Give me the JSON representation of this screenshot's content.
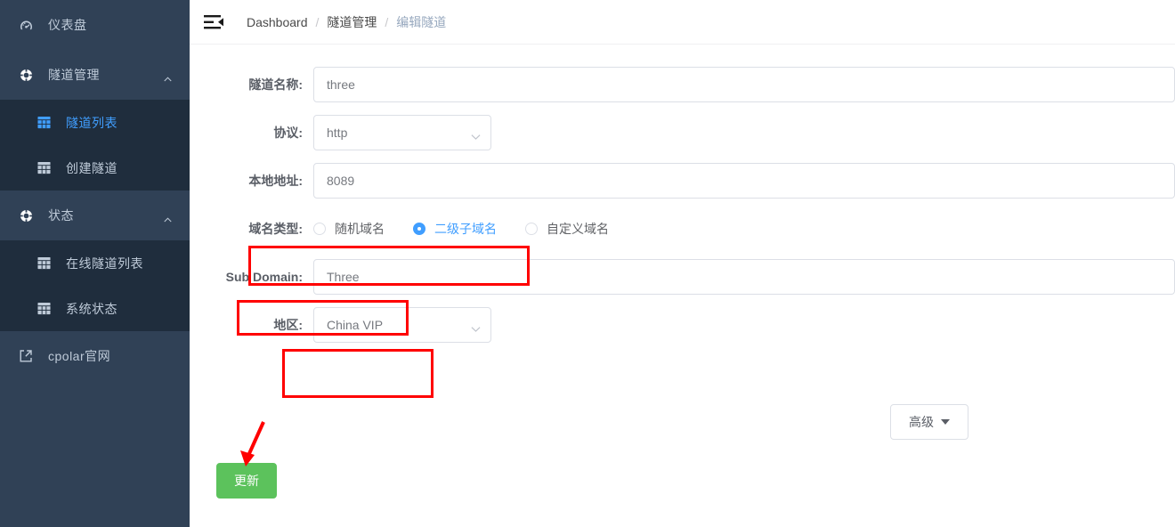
{
  "sidebar": {
    "items": [
      {
        "label": "仪表盘",
        "icon": "dashboard-gauge-icon",
        "type": "top",
        "active": false,
        "expandable": false
      },
      {
        "label": "隧道管理",
        "icon": "tunnel-compass-icon",
        "type": "top",
        "active": false,
        "expandable": true,
        "expanded": true
      },
      {
        "label": "隧道列表",
        "icon": "table-grid-icon",
        "type": "sub",
        "active": true
      },
      {
        "label": "创建隧道",
        "icon": "table-grid-icon",
        "type": "sub",
        "active": false
      },
      {
        "label": "状态",
        "icon": "status-compass-icon",
        "type": "top",
        "active": false,
        "expandable": true,
        "expanded": true
      },
      {
        "label": "在线隧道列表",
        "icon": "table-grid-icon",
        "type": "sub",
        "active": false
      },
      {
        "label": "系统状态",
        "icon": "table-grid-icon",
        "type": "sub",
        "active": false
      },
      {
        "label": "cpolar官网",
        "icon": "external-link-icon",
        "type": "top",
        "active": false,
        "expandable": false
      }
    ]
  },
  "navbar": {
    "menu_toggle_icon": "menu-fold-icon",
    "breadcrumb": [
      {
        "label": "Dashboard",
        "current": false
      },
      {
        "label": "隧道管理",
        "current": false
      },
      {
        "label": "编辑隧道",
        "current": true
      }
    ],
    "separator": "/"
  },
  "form": {
    "tunnel_name": {
      "label": "隧道名称:",
      "value": "three"
    },
    "protocol": {
      "label": "协议:",
      "value": "http",
      "caret_icon": "chevron-down-icon"
    },
    "local_address": {
      "label": "本地地址:",
      "value": "8089"
    },
    "domain_type": {
      "label": "域名类型:",
      "options": [
        {
          "label": "随机域名",
          "checked": false
        },
        {
          "label": "二级子域名",
          "checked": true
        },
        {
          "label": "自定义域名",
          "checked": false
        }
      ]
    },
    "sub_domain": {
      "label": "Sub Domain:",
      "value": "Three"
    },
    "region": {
      "label": "地区:",
      "value": "China VIP",
      "caret_icon": "chevron-down-icon"
    },
    "advanced_button": {
      "label": "高级",
      "caret_icon": "caret-down-icon"
    },
    "update_button": {
      "label": "更新"
    }
  },
  "colors": {
    "sidebar_bg": "#304156",
    "submenu_bg": "#1f2d3d",
    "accent_blue": "#409eff",
    "update_green": "#5cc25c",
    "annotation_red": "#ff0000",
    "label_text": "#5a5e66",
    "muted_text": "#97a8be"
  },
  "annotations": {
    "boxes": [
      {
        "target": "domain-type-row"
      },
      {
        "target": "sub-domain-row"
      },
      {
        "target": "region-row"
      }
    ],
    "arrow": {
      "target": "update-button",
      "color": "#ff0000"
    }
  }
}
